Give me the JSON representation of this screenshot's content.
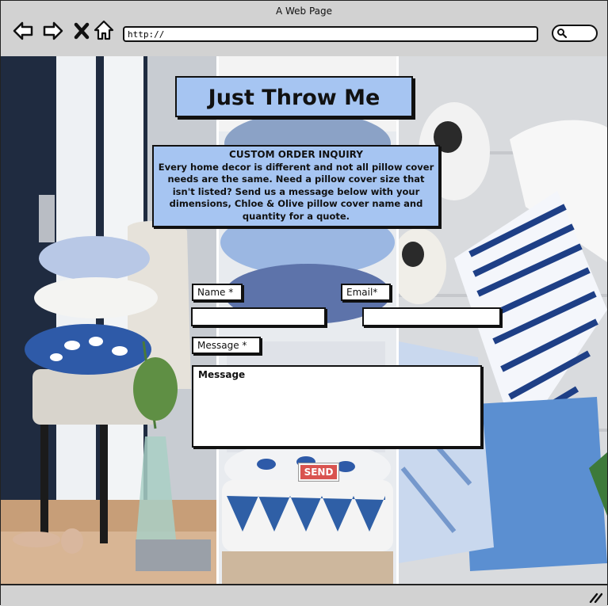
{
  "window": {
    "title": "A Web Page"
  },
  "browser": {
    "url": "http://",
    "icons": [
      "back-arrow-icon",
      "forward-arrow-icon",
      "close-x-icon",
      "home-icon",
      "search-icon",
      "resize-grip-icon"
    ]
  },
  "site": {
    "title": "Just Throw Me"
  },
  "inquiry": {
    "heading": "CUSTOM ORDER INQUIRY",
    "body": "Every home decor is different and not all pillow cover needs are the same. Need a pillow cover size that isn't listed? Send us a message below with your dimensions, Chloe & Olive pillow cover name and quantity for a quote."
  },
  "form": {
    "name_label": "Name *",
    "email_label": "Email*",
    "message_label": "Message *",
    "message_placeholder": "Message",
    "send_label": "SEND"
  },
  "colors": {
    "accent_blue": "#a6c5f2",
    "send_red": "#d9534f",
    "chrome_gray": "#d2d2d2"
  }
}
